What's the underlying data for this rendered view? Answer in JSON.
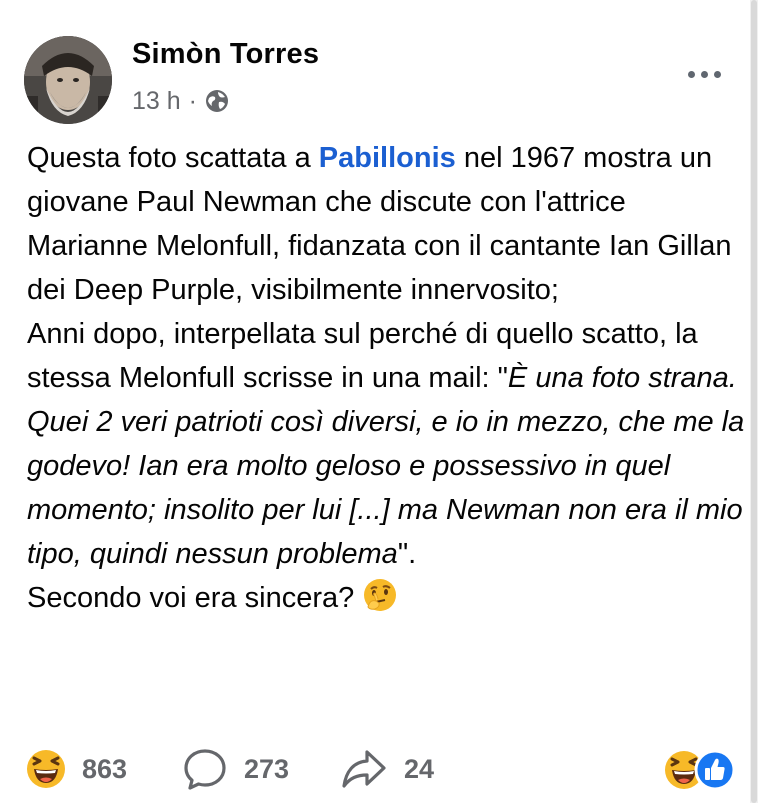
{
  "post": {
    "author": "Simòn Torres",
    "time": "13 h",
    "separator": "·",
    "privacy_icon": "globe-icon",
    "more_icon": "more-horizontal-icon",
    "text": {
      "p1_before_mention": "Questa foto scattata a ",
      "mention": "Pabillonis",
      "p1_after_mention": " nel 1967 mostra un giovane Paul Newman che discute con l'attrice Marianne Melonfull, fidanzata con il cantante Ian Gillan dei Deep Purple, visibilmente innervosito;",
      "p2_intro": "Anni dopo, interpellata sul perché di quello scatto, la stessa Melonfull scrisse in una mail: \"",
      "p2_quote": "È una foto strana. Quei 2 veri patrioti così diversi, e io in mezzo, che me la godevo! Ian era molto geloso e possessivo in quel momento; insolito per lui [...] ma Newman non era il mio tipo, quindi nessun problema",
      "p2_end": "\".",
      "p3": "Secondo voi era sincera? ",
      "p3_emoji": "thinking-face-emoji"
    }
  },
  "footer": {
    "reactions_count": "863",
    "reaction_emoji": "laughing-face-emoji",
    "comments_count": "273",
    "comment_icon": "comment-bubble-icon",
    "shares_count": "24",
    "share_icon": "share-arrow-icon",
    "summary_icons": [
      "laughing-face-emoji",
      "like-thumb-icon"
    ]
  },
  "colors": {
    "mention": "#1b5fd1",
    "meta_gray": "#65676b",
    "like_blue": "#1877f2",
    "emoji_yellow": "#f7b928"
  }
}
